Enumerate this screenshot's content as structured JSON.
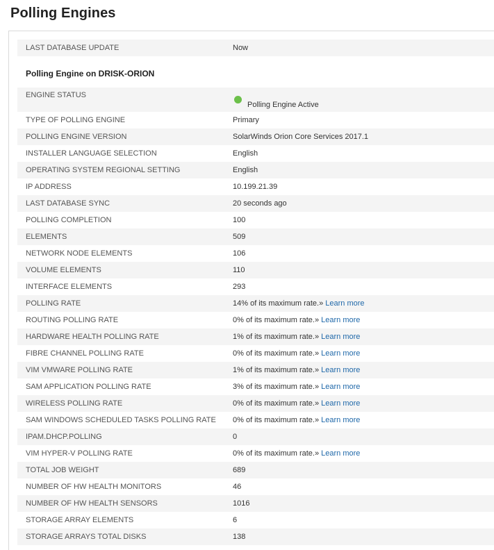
{
  "page": {
    "title": "Polling Engines"
  },
  "last_update": {
    "label": "LAST DATABASE UPDATE",
    "value": "Now"
  },
  "section": {
    "title": "Polling Engine on DRISK-ORION"
  },
  "status": {
    "label": "ENGINE STATUS",
    "value": "Polling Engine Active",
    "color": "#6cc04a"
  },
  "learn_more": "Learn more",
  "rows": [
    {
      "label": "TYPE OF POLLING ENGINE",
      "value": "Primary"
    },
    {
      "label": "POLLING ENGINE VERSION",
      "value": "SolarWinds Orion Core Services 2017.1"
    },
    {
      "label": "INSTALLER LANGUAGE SELECTION",
      "value": "English"
    },
    {
      "label": "OPERATING SYSTEM REGIONAL SETTING",
      "value": "English"
    },
    {
      "label": "IP ADDRESS",
      "value": "10.199.21.39"
    },
    {
      "label": "LAST DATABASE SYNC",
      "value": "20 seconds ago"
    },
    {
      "label": "POLLING COMPLETION",
      "value": "100"
    },
    {
      "label": "ELEMENTS",
      "value": "509"
    },
    {
      "label": "NETWORK NODE ELEMENTS",
      "value": "106"
    },
    {
      "label": "VOLUME ELEMENTS",
      "value": "110"
    },
    {
      "label": "INTERFACE ELEMENTS",
      "value": "293"
    },
    {
      "label": "POLLING RATE",
      "value": "14% of its maximum rate.»"
    },
    {
      "label": "ROUTING POLLING RATE",
      "value": "0% of its maximum rate.»"
    },
    {
      "label": "HARDWARE HEALTH POLLING RATE",
      "value": "1% of its maximum rate.»"
    },
    {
      "label": "FIBRE CHANNEL POLLING RATE",
      "value": "0% of its maximum rate.»"
    },
    {
      "label": "VIM VMWARE POLLING RATE",
      "value": "1% of its maximum rate.»"
    },
    {
      "label": "SAM APPLICATION POLLING RATE",
      "value": "3% of its maximum rate.»"
    },
    {
      "label": "WIRELESS POLLING RATE",
      "value": "0% of its maximum rate.»"
    },
    {
      "label": "SAM WINDOWS SCHEDULED TASKS POLLING RATE",
      "value": "0% of its maximum rate.»"
    },
    {
      "label": "IPAM.DHCP.POLLING",
      "value": "0"
    },
    {
      "label": "VIM HYPER-V POLLING RATE",
      "value": "0% of its maximum rate.»"
    },
    {
      "label": "TOTAL JOB WEIGHT",
      "value": "689"
    },
    {
      "label": "NUMBER OF HW HEALTH MONITORS",
      "value": "46"
    },
    {
      "label": "NUMBER OF HW HEALTH SENSORS",
      "value": "1016"
    },
    {
      "label": "STORAGE ARRAY ELEMENTS",
      "value": "6"
    },
    {
      "label": "STORAGE ARRAYS TOTAL DISKS",
      "value": "138"
    }
  ]
}
